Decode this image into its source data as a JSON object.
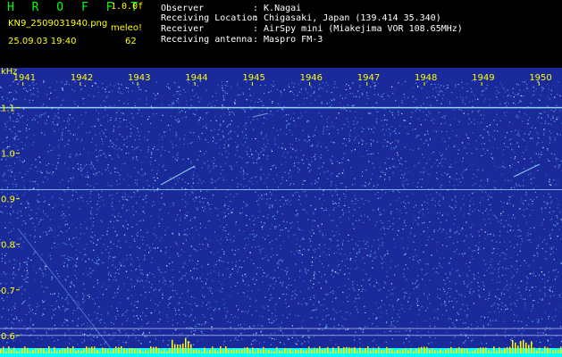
{
  "header": {
    "app_name": "H R O F F T",
    "version": "1.0.0f",
    "filename": "KN9_2509031940.png",
    "meleo_label": "meleo!",
    "datetime": "25.09.03 19:40",
    "count": "62",
    "info": [
      {
        "label": "Observer",
        "value": ": K.Nagai"
      },
      {
        "label": "Receiving Location",
        "value": ": Chigasaki, Japan (139.414 35.340)"
      },
      {
        "label": "Receiver",
        "value": ": AirSpy mini (Miakejima VOR 108.65MHz)"
      },
      {
        "label": "Receiving antenna",
        "value": ": Maspro FM-3"
      }
    ]
  },
  "chart_data": {
    "type": "heatmap",
    "ylabel": "kHz",
    "y_ticks": [
      {
        "value": 1.1,
        "label": "1.1"
      },
      {
        "value": 1.0,
        "label": "1.0"
      },
      {
        "value": 0.9,
        "label": "0.9"
      },
      {
        "value": 0.8,
        "label": "0.8"
      },
      {
        "value": 0.7,
        "label": "0.7"
      },
      {
        "value": 0.6,
        "label": "0.6"
      }
    ],
    "ylim": [
      0.58,
      1.16
    ],
    "x_ticks": [
      "1941",
      "1942",
      "1943",
      "1944",
      "1945",
      "1946",
      "1947",
      "1948",
      "1949",
      "1950"
    ],
    "xlim": [
      1940.6,
      1950.4
    ],
    "horizontal_lines_khz": [
      1.1,
      0.92,
      0.615,
      0.6
    ],
    "colors": {
      "background": "#1a2a9a",
      "noise": "#7fdcff",
      "signal": "#9fe8ff",
      "bottom_bar": "#00ffff",
      "bottom_peaks": "#ffff00",
      "axis_text": "#ffff00"
    }
  }
}
